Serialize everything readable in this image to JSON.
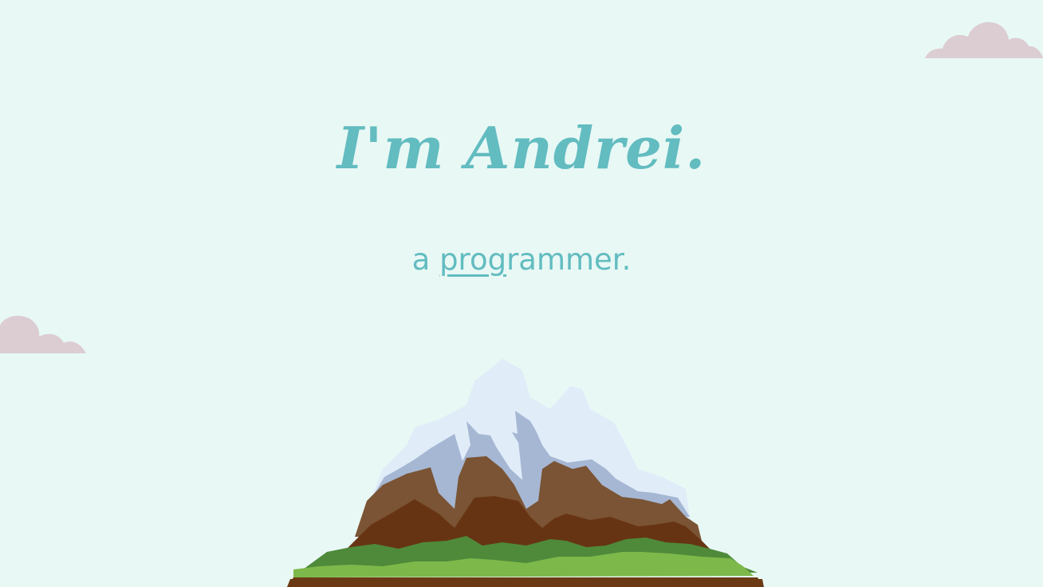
{
  "hero": {
    "title": "I'm Andrei.",
    "subtitle_prefix": "a",
    "typed_word_typed": "prog",
    "typed_word_rest": "rammer."
  },
  "colors": {
    "background": "#e8f8f5",
    "accent": "#62bcc0",
    "cloud": "#dccdd2"
  },
  "decorations": {
    "clouds": [
      "cloud-icon",
      "cloud-icon"
    ],
    "illustration": "mountain-icon"
  }
}
